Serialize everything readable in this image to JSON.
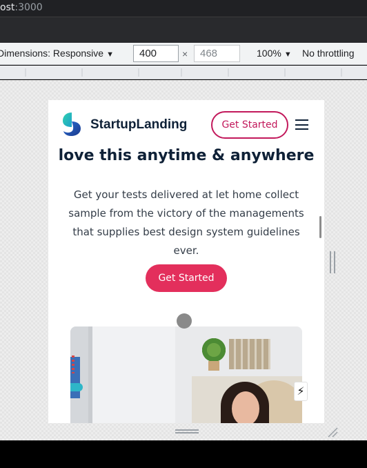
{
  "browser": {
    "url_host": "ost",
    "url_port": ":3000"
  },
  "devtools": {
    "dimensions_label": "Dimensions: Responsive",
    "width_value": "400",
    "times_symbol": "×",
    "height_value": "468",
    "zoom_label": "100%",
    "throttling_label": "No throttling",
    "dropdown_caret": "▼"
  },
  "site": {
    "brand_name": "StartupLanding",
    "nav_cta_label": "Get Started",
    "headline": "love this anytime & anywhere",
    "description": "Get your tests delivered at let home collect sample from the victory of the managements that supplies best design system guidelines ever.",
    "hero_cta_label": "Get Started",
    "lightning_glyph": "⚡"
  },
  "colors": {
    "accent": "#e32f5c",
    "nav_cta_border": "#c2185b",
    "heading": "#0f2137",
    "body_text": "#343d48"
  },
  "icons": {
    "logo": "startup-logo-icon",
    "menu": "hamburger-menu-icon",
    "lightning": "lightning-icon"
  }
}
